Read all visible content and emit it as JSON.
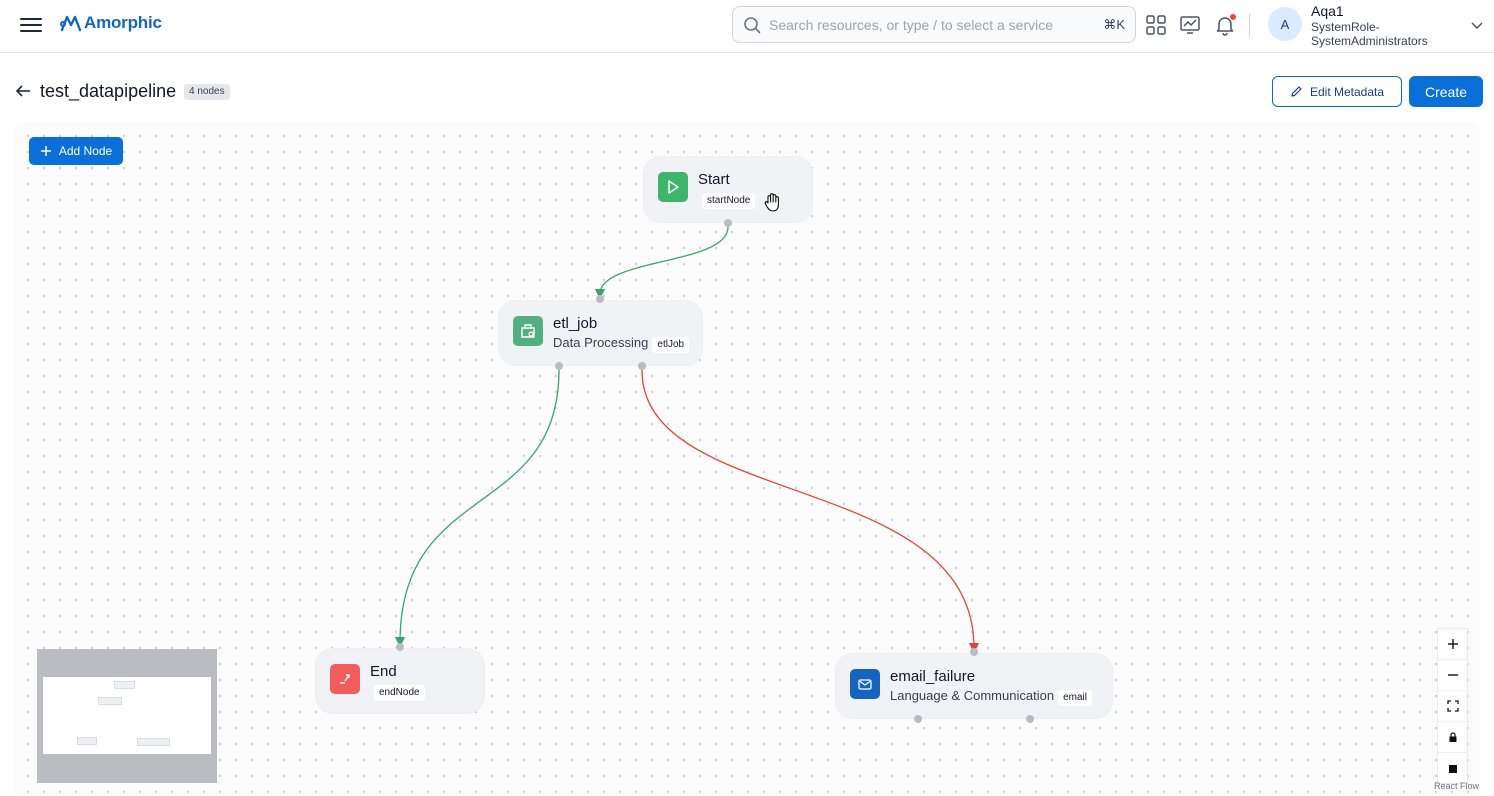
{
  "brand": {
    "name": "Amorphic",
    "color": "#1565c0"
  },
  "search": {
    "placeholder": "Search resources, or type / to select a service",
    "shortcut": "⌘K"
  },
  "topbar_icons": [
    "apps-grid-icon",
    "monitor-chart-icon",
    "bell-icon"
  ],
  "user": {
    "initial": "A",
    "name": "Aqa1",
    "role": "SystemRole-SystemAdministrators"
  },
  "page": {
    "title": "test_datapipeline",
    "node_count": "4 nodes"
  },
  "actions": {
    "edit_metadata": "Edit Metadata",
    "create": "Create",
    "add_node": "Add Node"
  },
  "nodes": {
    "start": {
      "title": "Start",
      "type": "startNode",
      "icon": "play-icon",
      "color": "#3fb56b"
    },
    "etl": {
      "title": "etl_job",
      "category": "Data Processing",
      "type": "etlJob",
      "icon": "etl-icon",
      "color": "#53b07e"
    },
    "end": {
      "title": "End",
      "type": "endNode",
      "icon": "exit-icon",
      "color": "#f25c5c"
    },
    "email": {
      "title": "email_failure",
      "category": "Language & Communication",
      "type": "email",
      "icon": "mail-icon",
      "color": "#1565c0"
    }
  },
  "edges": [
    {
      "from": "Start",
      "to": "etl_job",
      "status": "success",
      "color": "#3aa66b"
    },
    {
      "from": "etl_job",
      "to": "End",
      "status": "success",
      "color": "#3aa66b"
    },
    {
      "from": "etl_job",
      "to": "email_failure",
      "status": "failure",
      "color": "#e0453a"
    }
  ],
  "controls": [
    "zoom-in-icon",
    "zoom-out-icon",
    "fit-view-icon",
    "lock-icon",
    "square-icon"
  ],
  "attribution": "React Flow"
}
